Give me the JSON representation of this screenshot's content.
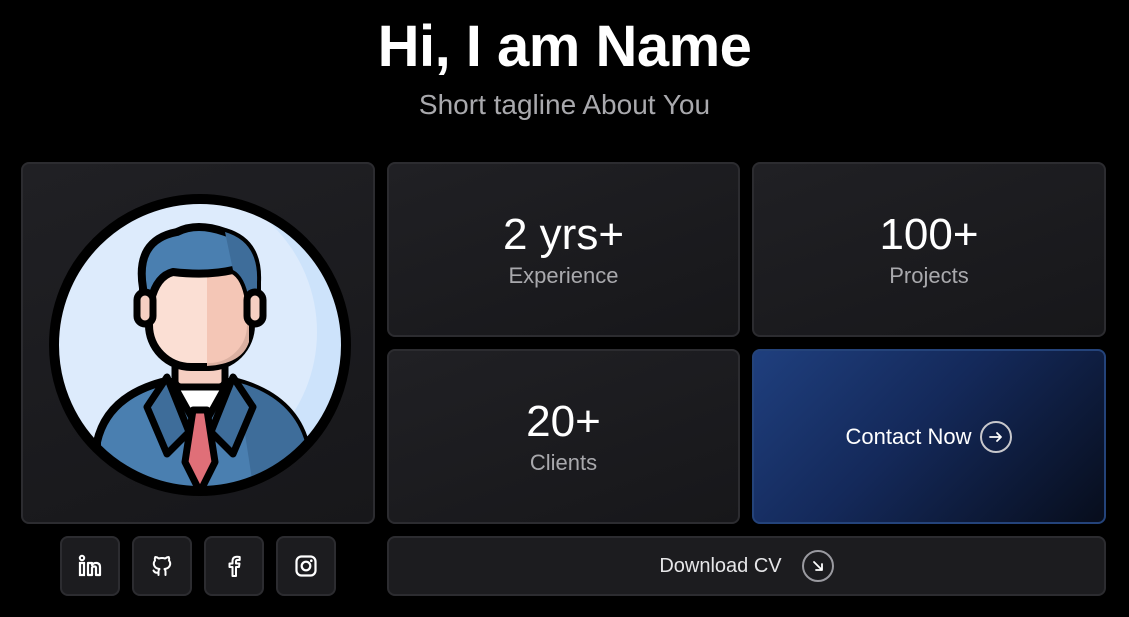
{
  "hero": {
    "title": "Hi, I am Name",
    "tagline": "Short tagline About You"
  },
  "profile": {
    "avatar_icon": "businessman-avatar-icon"
  },
  "stats": [
    {
      "value": "2 yrs+",
      "label": "Experience"
    },
    {
      "value": "100+",
      "label": "Projects"
    },
    {
      "value": "20+",
      "label": "Clients"
    }
  ],
  "contact": {
    "label": "Contact Now",
    "icon": "arrow-right-icon"
  },
  "socials": [
    {
      "icon": "linkedin-icon"
    },
    {
      "icon": "github-icon"
    },
    {
      "icon": "facebook-icon"
    },
    {
      "icon": "instagram-icon"
    }
  ],
  "download": {
    "label": "Download CV",
    "icon": "arrow-down-right-icon"
  },
  "colors": {
    "background": "#000000",
    "card": "#1c1c1f",
    "card_border": "#2c2c30",
    "accent_blue": "#1f3f7e",
    "muted_text": "#a9a9ad"
  }
}
